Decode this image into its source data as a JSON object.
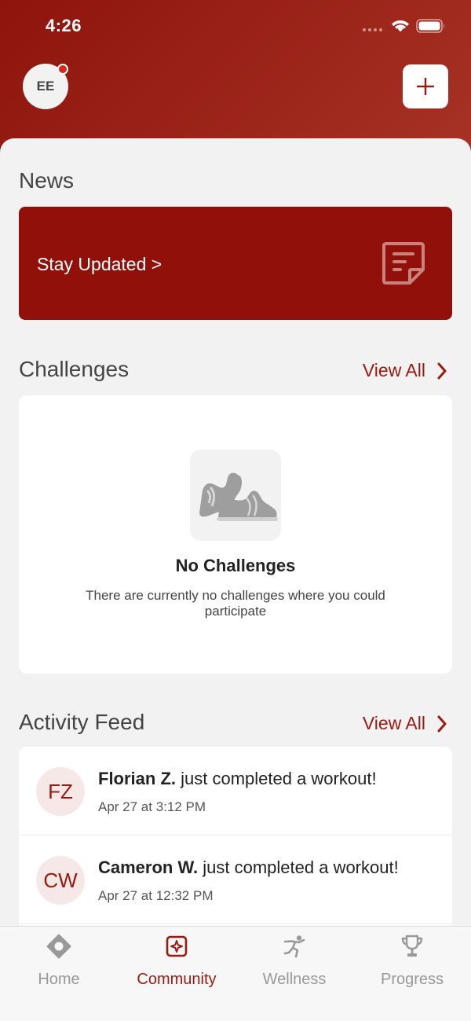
{
  "status_bar": {
    "time": "4:26"
  },
  "header": {
    "avatar_initials": "EE"
  },
  "news": {
    "title": "News",
    "card_label": "Stay Updated >"
  },
  "challenges": {
    "title": "Challenges",
    "view_all": "View All",
    "empty_title": "No Challenges",
    "empty_description": "There are currently no challenges where you could participate"
  },
  "activity_feed": {
    "title": "Activity Feed",
    "view_all": "View All",
    "items": [
      {
        "initials": "FZ",
        "name": "Florian Z.",
        "action": " just completed a workout!",
        "time": "Apr 27 at 3:12 PM"
      },
      {
        "initials": "CW",
        "name": "Cameron W.",
        "action": " just completed a workout!",
        "time": "Apr 27 at 12:32 PM"
      }
    ]
  },
  "tabbar": {
    "tabs": [
      {
        "label": "Home",
        "icon": "home-icon"
      },
      {
        "label": "Community",
        "icon": "community-icon"
      },
      {
        "label": "Wellness",
        "icon": "wellness-icon"
      },
      {
        "label": "Progress",
        "icon": "trophy-icon"
      }
    ],
    "active": "Community"
  },
  "colors": {
    "brand": "#91110a",
    "accent": "#9a1a10",
    "background": "#f2f2f2",
    "notification": "#d8281b"
  }
}
